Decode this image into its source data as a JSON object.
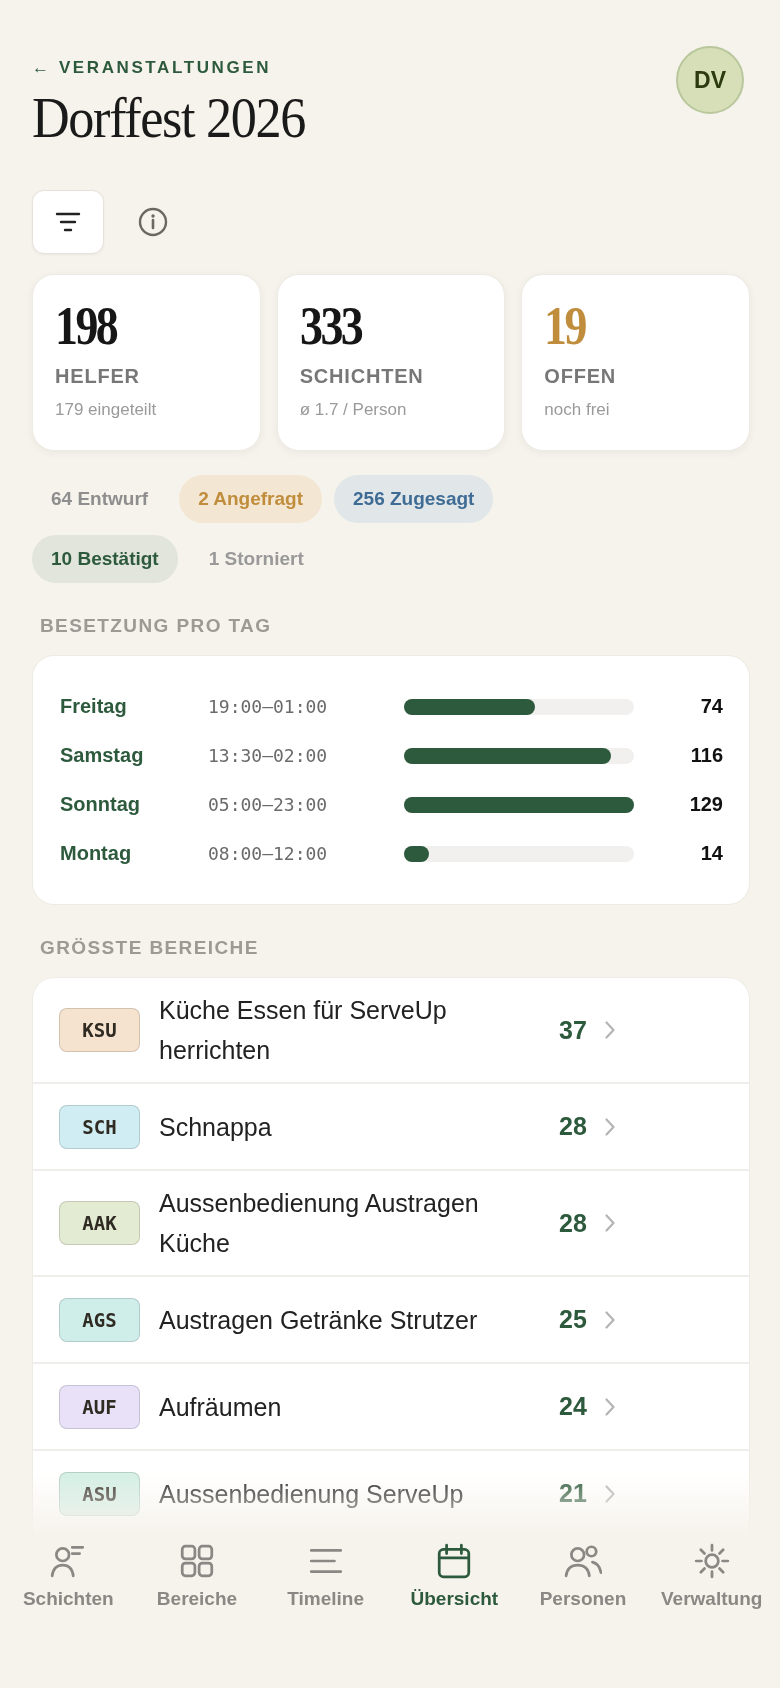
{
  "header": {
    "back_link": "← VERANSTALTUNGEN",
    "title": "Dorffest 2026",
    "avatar": "DV"
  },
  "stats": [
    {
      "value": "198",
      "label": "HELFER",
      "sub": "179 eingeteilt",
      "kind": "normal"
    },
    {
      "value": "333",
      "label": "SCHICHTEN",
      "sub": "ø 1.7 / Person",
      "kind": "normal"
    },
    {
      "value": "19",
      "label": "OFFEN",
      "sub": "noch frei",
      "kind": "warning"
    }
  ],
  "status_chips": [
    {
      "label": "64 Entwurf",
      "kind": "draft"
    },
    {
      "label": "2 Angefragt",
      "kind": "requested"
    },
    {
      "label": "256 Zugesagt",
      "kind": "promised"
    },
    {
      "label": "10 Bestätigt",
      "kind": "confirmed"
    },
    {
      "label": "1 Storniert",
      "kind": "cancelled"
    }
  ],
  "days_heading": "BESETZUNG PRO TAG",
  "days": [
    {
      "day": "Freitag",
      "time": "19:00–01:00",
      "level": 0.57,
      "count": "74"
    },
    {
      "day": "Samstag",
      "time": "13:30–02:00",
      "level": 0.9,
      "count": "116"
    },
    {
      "day": "Sonntag",
      "time": "05:00–23:00",
      "level": 1,
      "count": "129"
    },
    {
      "day": "Montag",
      "time": "08:00–12:00",
      "level": 0.11,
      "count": "14"
    }
  ],
  "areas_heading": "GRÖSSTE BEREICHE",
  "areas": [
    {
      "code": "KSU",
      "name": "Küche Essen für ServeUp herrichten",
      "count": "37",
      "color": "#f5e3cf"
    },
    {
      "code": "SCH",
      "name": "Schnappa",
      "count": "28",
      "color": "#cfedf2"
    },
    {
      "code": "AAK",
      "name": "Aussenbedienung Austragen Küche",
      "count": "28",
      "color": "#e3ebd3"
    },
    {
      "code": "AGS",
      "name": "Austragen Getränke Strutzer",
      "count": "25",
      "color": "#cfeeea"
    },
    {
      "code": "AUF",
      "name": "Aufräumen",
      "count": "24",
      "color": "#e8e1f8"
    },
    {
      "code": "ASU",
      "name": "Aussenbedienung ServeUp",
      "count": "21",
      "color": "#d3efe5"
    }
  ],
  "nav": [
    {
      "label": "Schichten",
      "selected": false
    },
    {
      "label": "Bereiche",
      "selected": false
    },
    {
      "label": "Timeline",
      "selected": false
    },
    {
      "label": "Übersicht",
      "selected": true
    },
    {
      "label": "Personen",
      "selected": false
    },
    {
      "label": "Verwaltung",
      "selected": false
    }
  ]
}
